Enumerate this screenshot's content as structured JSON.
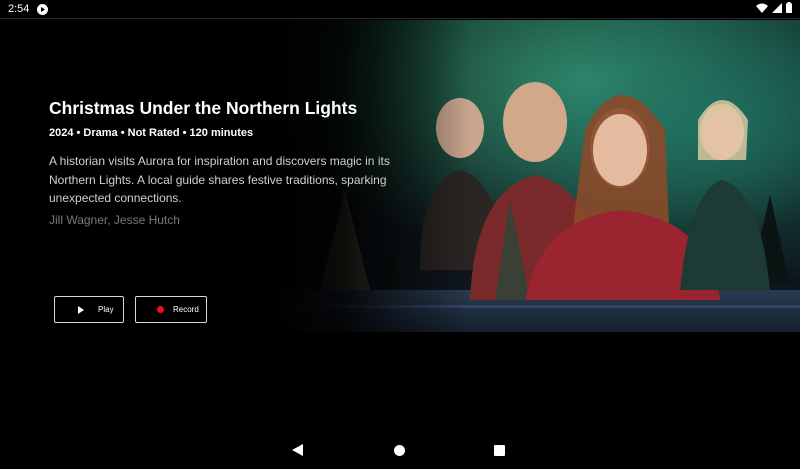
{
  "status_bar": {
    "time": "2:54",
    "icons": [
      "app-notification-icon",
      "wifi-icon",
      "cellular-signal-icon",
      "battery-icon"
    ]
  },
  "program": {
    "title": "Christmas Under the Northern Lights",
    "meta": "2024 • Drama • Not Rated • 120 minutes",
    "description": "A historian visits Aurora for inspiration and discovers magic in its Northern Lights. A local guide shares festive traditions, sparking unexpected connections.",
    "cast": "Jill Wagner, Jesse Hutch"
  },
  "actions": {
    "play_label": "Play",
    "record_label": "Record"
  },
  "colors": {
    "background": "#000000",
    "record_dot": "#e8141a",
    "aurora": "#2f8f6a"
  },
  "nav_bar": {
    "icons": [
      "back-icon",
      "home-icon",
      "recents-icon"
    ]
  }
}
